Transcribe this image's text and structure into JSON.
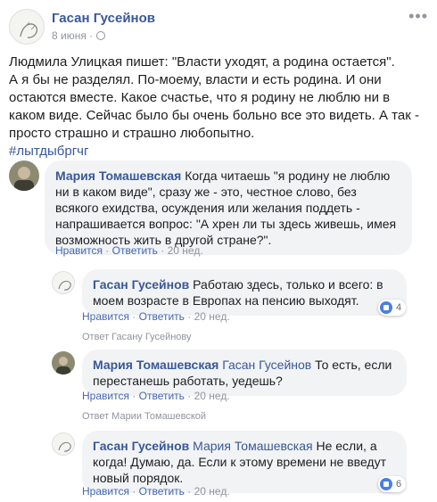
{
  "post": {
    "author": "Гасан Гусейнов",
    "date": "8 июня ·",
    "more_icon": "more-horizontal-icon",
    "paragraphs": [
      "Людмила Улицкая пишет: \"Власти уходят, а родина остается\".",
      "А я бы не разделял. По-моему, власти и есть родина. И они остаются вместе. Какое счастье, что я родину не люблю ни в каком виде. Сейчас было бы очень больно все это видеть. А так - просто страшно и страшно любопытно."
    ],
    "hashtag": "#лытдыбргчг"
  },
  "comments": [
    {
      "author": "Мария Томашевская",
      "text": "Когда читаешь \"я родину не люблю ни в каком виде\", сразу же - это, честное слово, без всякого ехидства, осуждения или желания поддеть - напрашивается вопрос: \"А хрен ли ты здесь живешь, имея возможность жить в другой стране?\".",
      "like": "Нравится",
      "reply": "Ответить",
      "time": "20 нед."
    },
    {
      "author": "Гасан Гусейнов",
      "text": "Работаю здесь, только и всего: в моем возрасте в Европах на пенсию выходят.",
      "like": "Нравится",
      "reply": "Ответить",
      "time": "20 нед.",
      "reactions": "4",
      "reply_to": "Ответ Гасану Гусейнову"
    },
    {
      "author": "Мария Томашевская",
      "mention": "Гасан Гусейнов",
      "text": "То есть, если перестанешь работать, уедешь?",
      "like": "Нравится",
      "reply": "Ответить",
      "time": "20 нед.",
      "reply_to": "Ответ Марии Томашевской"
    },
    {
      "author": "Гасан Гусейнов",
      "mention": "Мария Томашевская",
      "text": "Не если, а когда! Думаю, да. Если к этому времени не введут новый порядок.",
      "like": "Нравится",
      "reply": "Ответить",
      "time": "20 нед.",
      "reactions": "6"
    }
  ],
  "colors": {
    "link": "#385898",
    "bubble": "#f2f3f5",
    "meta": "#90949c"
  }
}
